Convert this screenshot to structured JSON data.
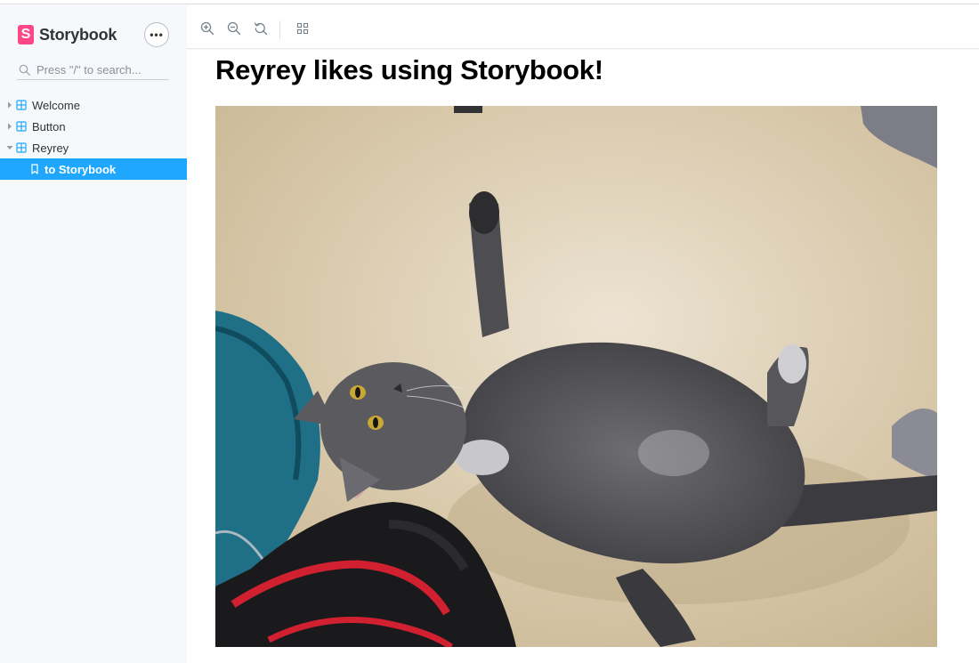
{
  "sidebar": {
    "brand": {
      "name": "Storybook",
      "logo_letter": "S",
      "color": "#ff4785"
    },
    "menu_label": "•••",
    "search": {
      "placeholder": "Press \"/\" to search...",
      "icon": "search-icon"
    },
    "items": [
      {
        "label": "Welcome",
        "type": "component",
        "expanded": false
      },
      {
        "label": "Button",
        "type": "component",
        "expanded": false
      },
      {
        "label": "Reyrey",
        "type": "component",
        "expanded": true
      },
      {
        "label": "to Storybook",
        "type": "story",
        "selected": true
      }
    ],
    "accent": "#1ea7fd"
  },
  "toolbar": {
    "buttons": [
      {
        "icon": "zoom-in-icon"
      },
      {
        "icon": "zoom-out-icon"
      },
      {
        "icon": "zoom-reset-icon"
      },
      {
        "icon": "grid-icon"
      }
    ]
  },
  "main": {
    "title": "Reyrey likes using Storybook!",
    "image": {
      "subject": "cat-photo"
    }
  }
}
